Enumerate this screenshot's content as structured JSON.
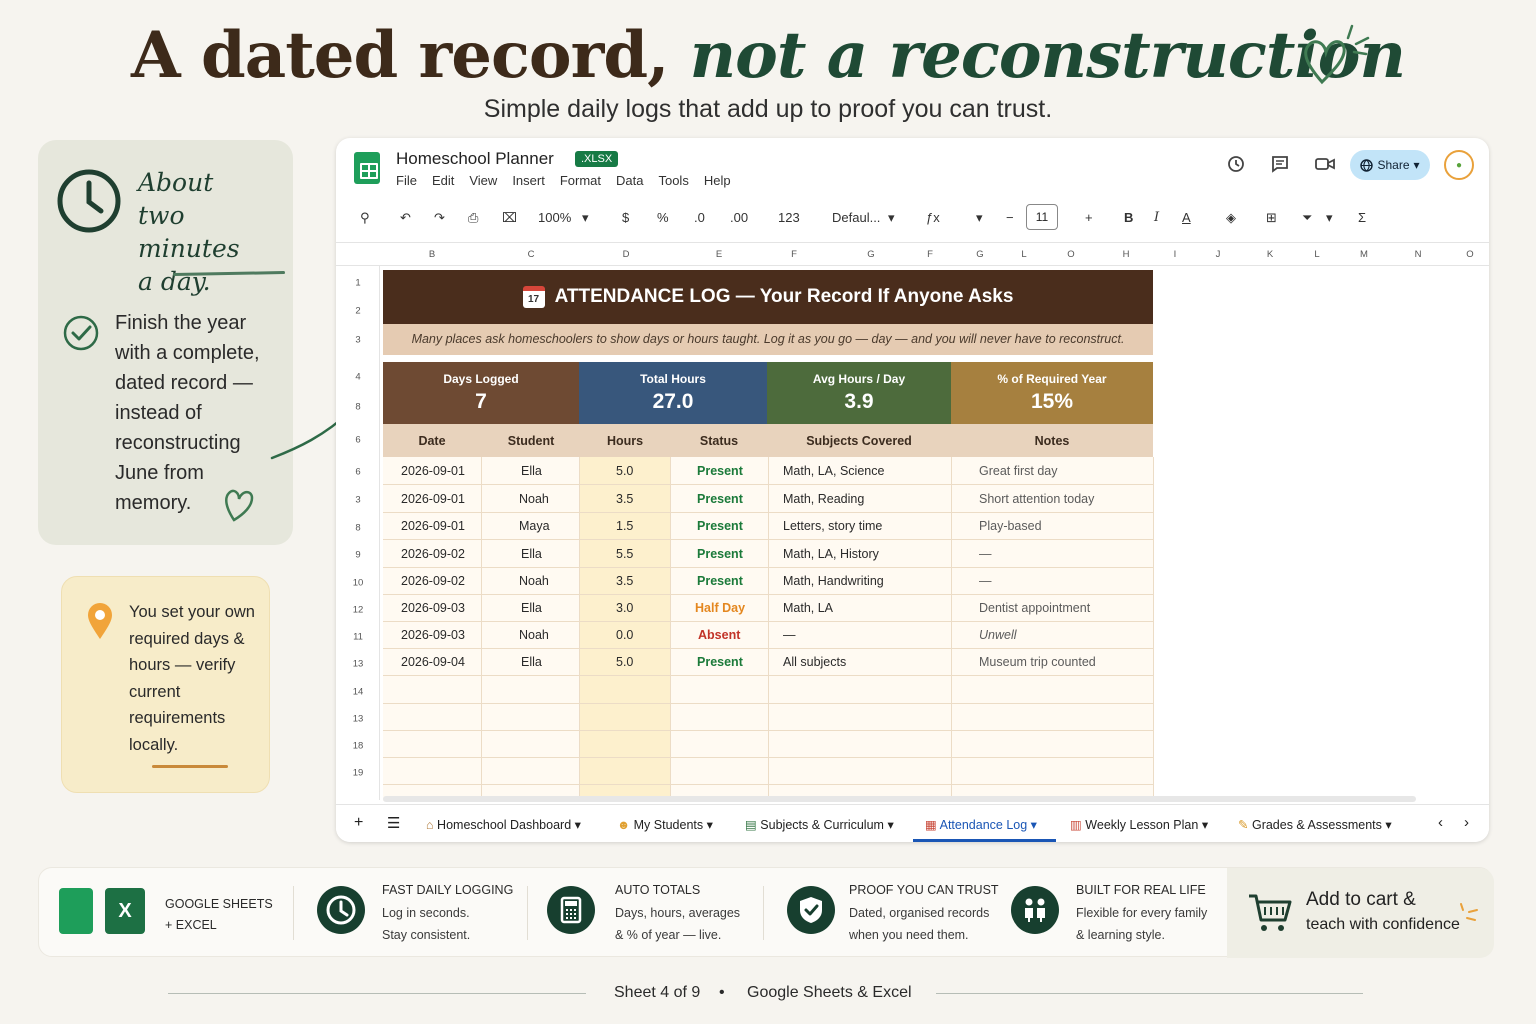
{
  "hero": {
    "title_plain": "A dated record,",
    "title_emph": "not a reconstruction",
    "subtitle": "Simple daily logs that add up to proof you can trust."
  },
  "card_time": {
    "line1": "About",
    "line2": "two minutes",
    "line3": "a day.",
    "finish_text": "Finish the year with a complete, dated record — instead of reconstructing June from memory."
  },
  "card_req": {
    "text": "You set your own required days & hours — verify current requirements locally."
  },
  "app": {
    "doc_title": "Homeschool Planner",
    "badge": ".XLSX",
    "menus": [
      "File",
      "Edit",
      "View",
      "Insert",
      "Format",
      "Data",
      "Tools",
      "Help"
    ],
    "share_label": "Share",
    "toolbar": {
      "zoom": "100%",
      "currency": "$",
      "percent": "%",
      "dec_less": ".0",
      "dec_more": ".00",
      "number_format": "123",
      "font": "Defaul...",
      "font_size": "11"
    },
    "columns": [
      "B",
      "C",
      "D",
      "E",
      "F",
      "G",
      "F",
      "G",
      "L",
      "O",
      "H",
      "I",
      "J",
      "K",
      "L",
      "M",
      "N",
      "O"
    ],
    "rows": [
      "1",
      "2",
      "3",
      "4",
      "8",
      "6",
      "6",
      "3",
      "8",
      "9",
      "10",
      "12",
      "11",
      "13",
      "14",
      "13",
      "18",
      "19"
    ]
  },
  "sheet": {
    "banner_icon": "17",
    "banner": "ATTENDANCE LOG — Your Record If Anyone Asks",
    "subbanner": "Many places ask homeschoolers to show days or hours taught. Log it as you go — day — and you will never have to reconstruct.",
    "stats": [
      {
        "label": "Days Logged",
        "value": "7",
        "color": "#6e4a33"
      },
      {
        "label": "Total Hours",
        "value": "27.0",
        "color": "#38577c"
      },
      {
        "label": "Avg Hours / Day",
        "value": "3.9",
        "color": "#4d6b3c"
      },
      {
        "label": "% of Required Year",
        "value": "15%",
        "color": "#a6803f"
      }
    ],
    "headers": [
      "Date",
      "Student",
      "Hours",
      "Status",
      "Subjects Covered",
      "Notes"
    ],
    "entries": [
      {
        "date": "2026-09-01",
        "student": "Ella",
        "hours": "5.0",
        "status": "Present",
        "subjects": "Math, LA, Science",
        "notes": "Great first day"
      },
      {
        "date": "2026-09-01",
        "student": "Noah",
        "hours": "3.5",
        "status": "Present",
        "subjects": "Math, Reading",
        "notes": "Short attention today"
      },
      {
        "date": "2026-09-01",
        "student": "Maya",
        "hours": "1.5",
        "status": "Present",
        "subjects": "Letters, story time",
        "notes": "Play-based"
      },
      {
        "date": "2026-09-02",
        "student": "Ella",
        "hours": "5.5",
        "status": "Present",
        "subjects": "Math, LA, History",
        "notes": "—"
      },
      {
        "date": "2026-09-02",
        "student": "Noah",
        "hours": "3.5",
        "status": "Present",
        "subjects": "Math, Handwriting",
        "notes": "—"
      },
      {
        "date": "2026-09-03",
        "student": "Ella",
        "hours": "3.0",
        "status": "Half Day",
        "subjects": "Math, LA",
        "notes": "Dentist appointment"
      },
      {
        "date": "2026-09-03",
        "student": "Noah",
        "hours": "0.0",
        "status": "Absent",
        "subjects": "—",
        "notes": "Unwell"
      },
      {
        "date": "2026-09-04",
        "student": "Ella",
        "hours": "5.0",
        "status": "Present",
        "subjects": "All subjects",
        "notes": "Museum trip counted"
      }
    ]
  },
  "tabs": [
    {
      "label": "Homeschool Dashboard",
      "icon": "house-icon"
    },
    {
      "label": "My Students",
      "icon": "students-icon"
    },
    {
      "label": "Subjects & Curriculum",
      "icon": "books-icon"
    },
    {
      "label": "Attendance Log",
      "icon": "calendar-icon",
      "active": true
    },
    {
      "label": "Weekly Lesson Plan",
      "icon": "planner-icon"
    },
    {
      "label": "Grades & Assessments",
      "icon": "pencil-icon"
    }
  ],
  "features": {
    "platform_line1": "GOOGLE SHEETS",
    "platform_line2": "+ EXCEL",
    "items": [
      {
        "title": "FAST DAILY LOGGING",
        "line1": "Log in seconds.",
        "line2": "Stay consistent.",
        "icon": "clock-icon"
      },
      {
        "title": "AUTO TOTALS",
        "line1": "Days, hours, averages",
        "line2": "& % of year — live.",
        "icon": "calculator-icon"
      },
      {
        "title": "PROOF YOU CAN TRUST",
        "line1": "Dated, organised records",
        "line2": "when you need them.",
        "icon": "shield-check-icon"
      },
      {
        "title": "BUILT FOR REAL LIFE",
        "line1": "Flexible for every family",
        "line2": "& learning style.",
        "icon": "family-icon"
      }
    ],
    "cart_line1": "Add to cart &",
    "cart_line2": "teach with confidence"
  },
  "footer": {
    "sheet_count": "Sheet 4 of 9",
    "dot": "•",
    "platforms": "Google Sheets & Excel"
  },
  "colors": {
    "brand_green": "#173f2f",
    "banner_brown": "#4a2d1c",
    "present": "#1b7a3a",
    "half_day": "#e4871f",
    "absent": "#c23428"
  }
}
